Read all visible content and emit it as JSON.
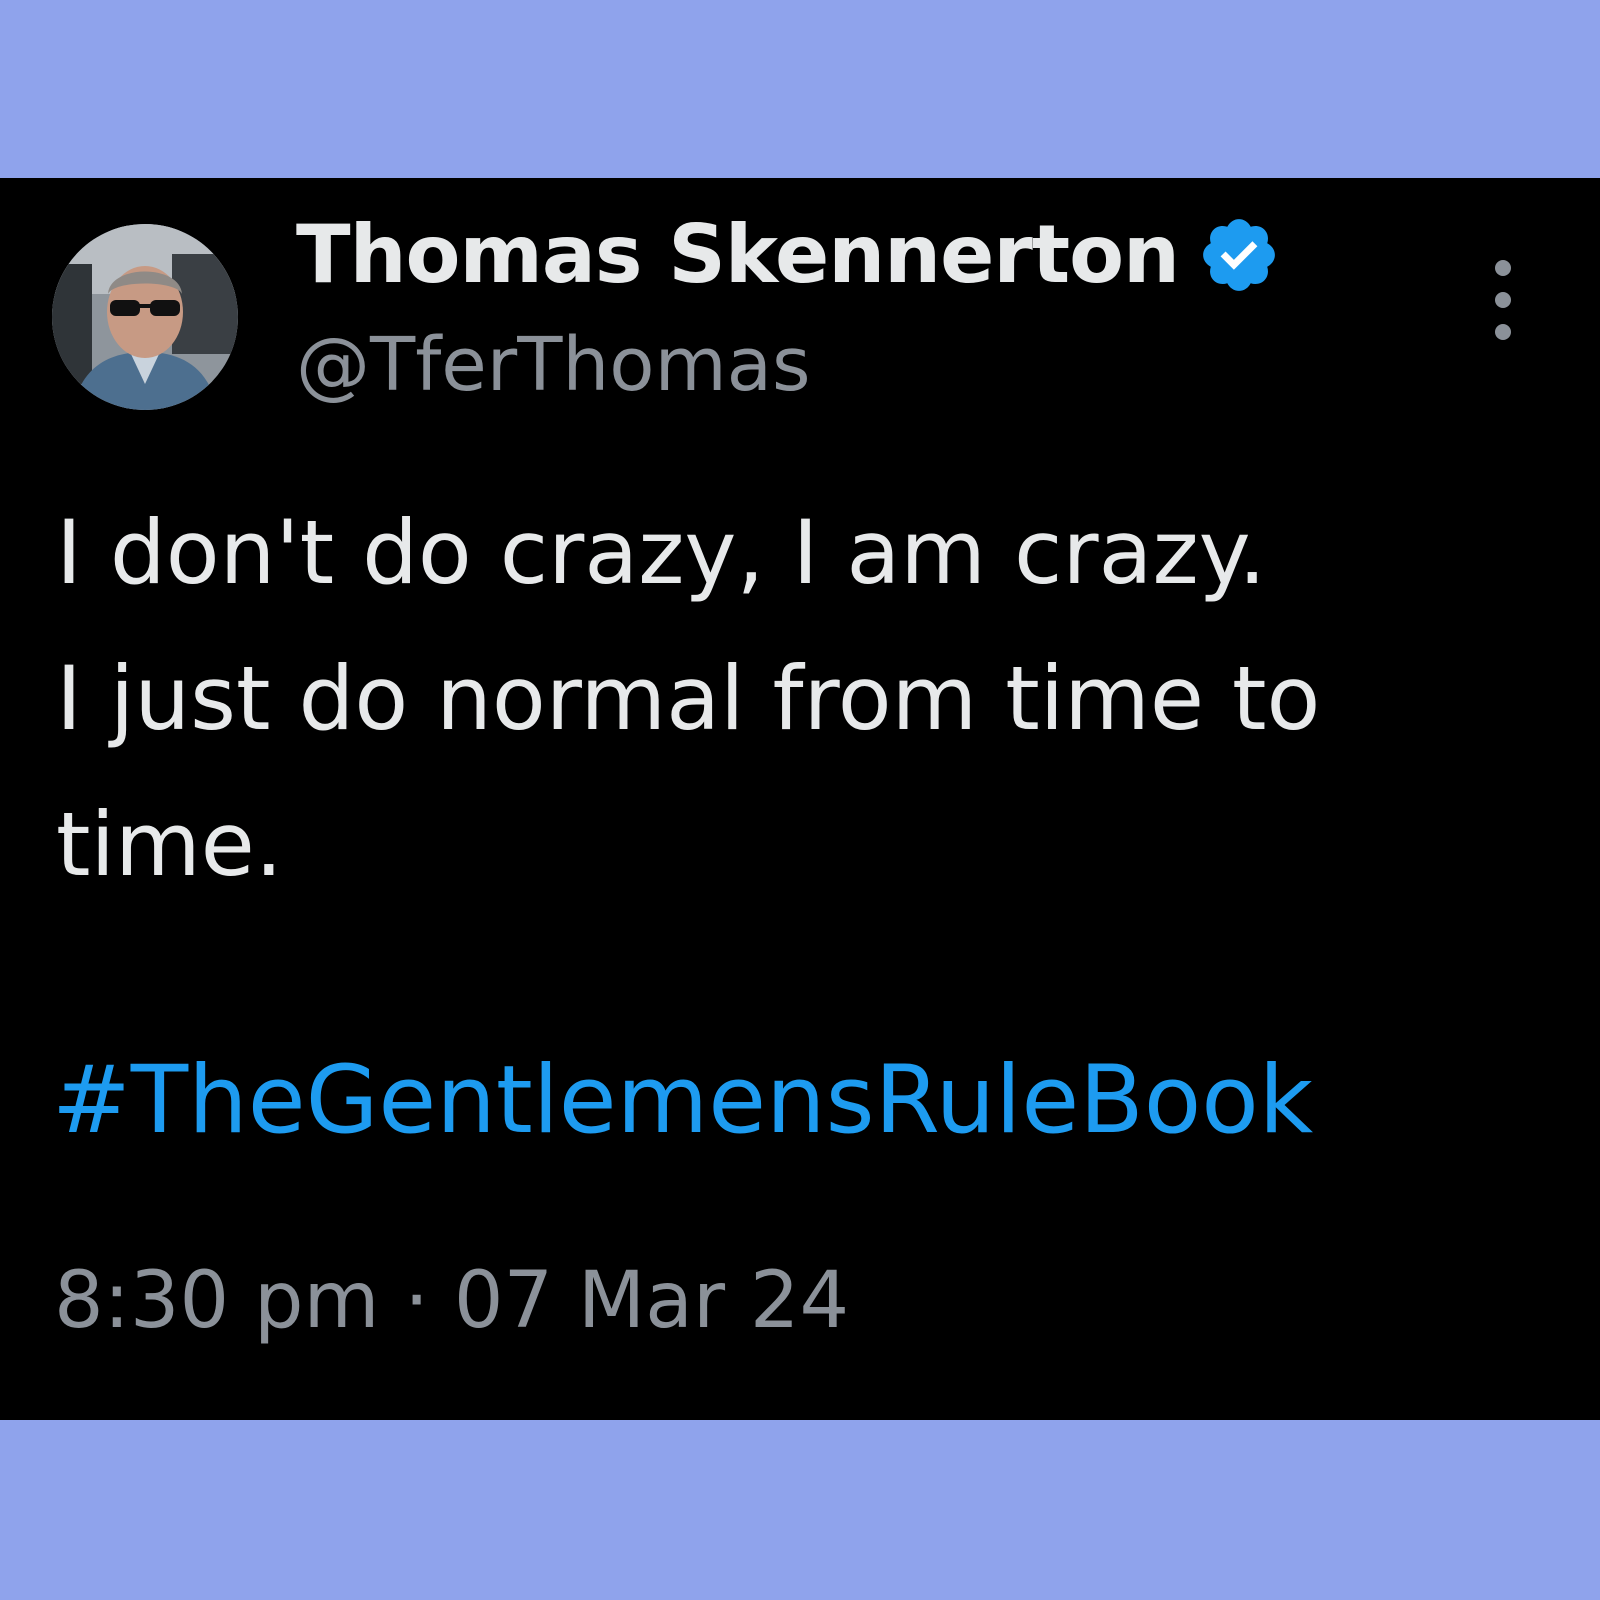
{
  "colors": {
    "page_background": "#8fa3ec",
    "card_background": "#000000",
    "primary_text": "#e7e9ea",
    "secondary_text": "#8b9199",
    "link": "#1d9bf0",
    "verified_badge": "#1d9bf0"
  },
  "tweet": {
    "author": {
      "display_name": "Thomas Skennerton",
      "handle": "@TferThomas",
      "verified": true,
      "avatar_icon": "profile-photo"
    },
    "more_icon": "more-vertical-icon",
    "body_lines": [
      "I don't do crazy, I am crazy.",
      "I just do normal from time to",
      "time."
    ],
    "hashtag": "#TheGentlemensRuleBook",
    "timestamp": "8:30 pm · 07 Mar 24"
  }
}
